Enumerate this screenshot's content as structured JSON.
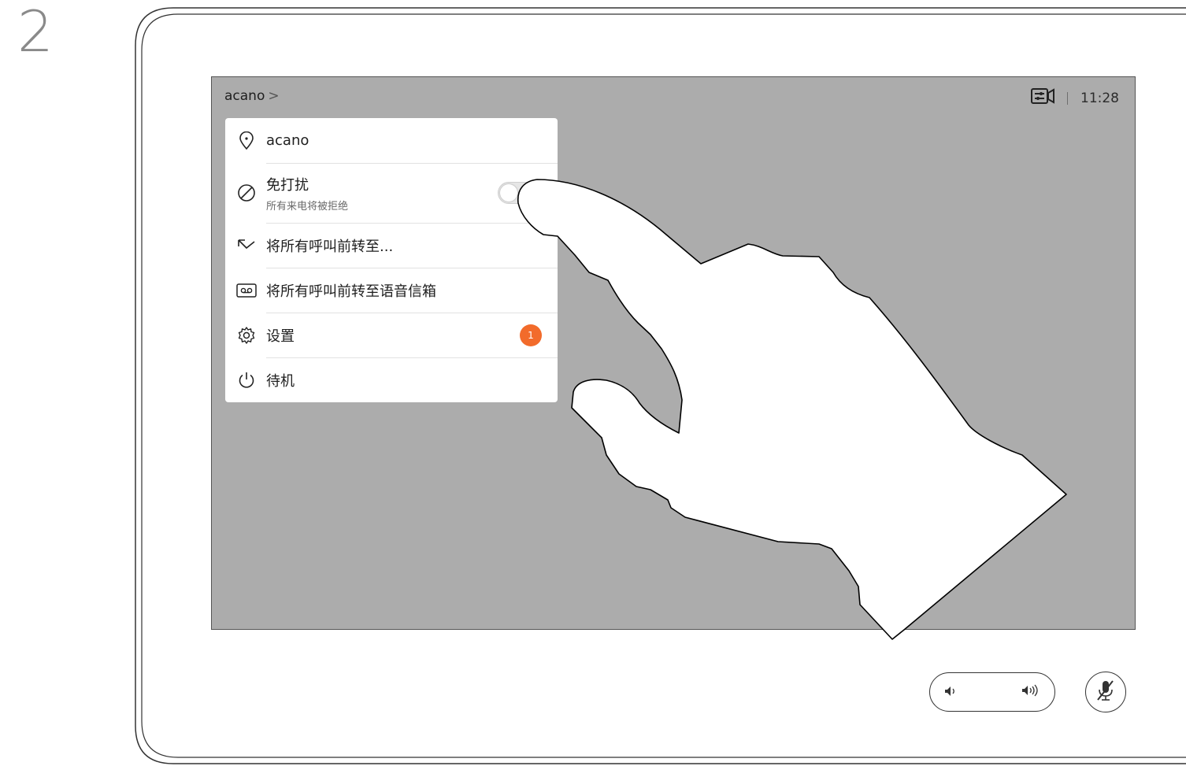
{
  "step": {
    "number": "2"
  },
  "header": {
    "name": "acano",
    "chevron": ">",
    "time": "11:28",
    "icons": {
      "chevron": "chevron-right-icon",
      "camera": "self-view-camera-icon"
    }
  },
  "menu": {
    "items": [
      {
        "label": "acano",
        "icon": "location-pin-icon"
      },
      {
        "label": "免打扰",
        "sub": "所有来电将被拒绝",
        "icon": "do-not-disturb-icon",
        "toggle_on": false
      },
      {
        "label": "将所有呼叫前转至...",
        "icon": "call-forward-icon"
      },
      {
        "label": "将所有呼叫前转至语音信箱",
        "icon": "voicemail-icon"
      },
      {
        "label": "设置",
        "icon": "gear-icon",
        "badge": "1"
      },
      {
        "label": "待机",
        "icon": "power-icon"
      }
    ],
    "badge_color": "#f26b2b"
  },
  "controls": {
    "volume": {
      "down_icon": "volume-down-icon",
      "up_icon": "volume-up-icon"
    },
    "mute": {
      "icon": "microphone-muted-icon"
    }
  },
  "colors": {
    "screen_bg": "#acacac",
    "accent": "#f26b2b"
  }
}
